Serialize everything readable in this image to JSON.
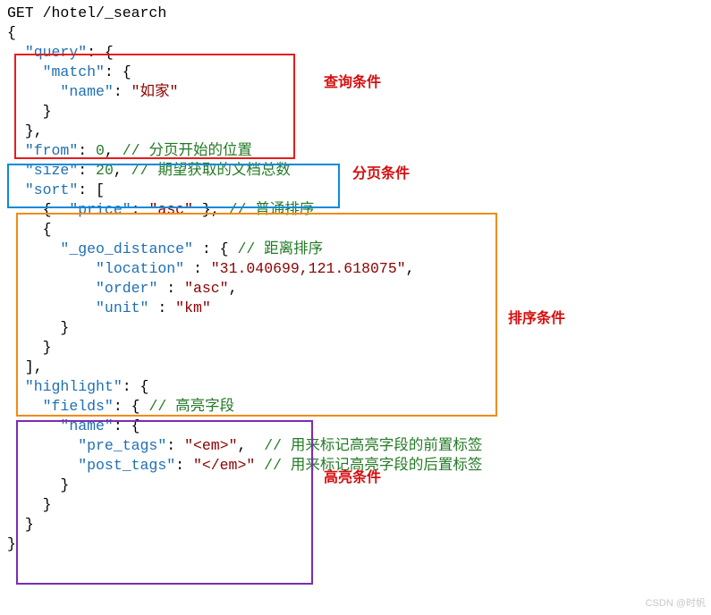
{
  "request_line": "GET /hotel/_search",
  "labels": {
    "query": "查询条件",
    "page": "分页条件",
    "sort": "排序条件",
    "highlight": "高亮条件"
  },
  "keys": {
    "query": "\"query\"",
    "match": "\"match\"",
    "name": "\"name\"",
    "from": "\"from\"",
    "size": "\"size\"",
    "sort": "\"sort\"",
    "price": "\"price\"",
    "geo": "\"_geo_distance\"",
    "location": "\"location\"",
    "order": "\"order\"",
    "unit": "\"unit\"",
    "highlight": "\"highlight\"",
    "fields": "\"fields\"",
    "pre_tags": "\"pre_tags\"",
    "post_tags": "\"post_tags\""
  },
  "vals": {
    "name": "\"如家\"",
    "from": "0",
    "size": "20",
    "asc": "\"asc\"",
    "loc": "\"31.040699,121.618075\"",
    "km": "\"km\"",
    "pre": "\"<em>\"",
    "post": "\"</em>\""
  },
  "comments": {
    "from": "// 分页开始的位置",
    "size": "// 期望获取的文档总数",
    "sort_plain": "// 普通排序",
    "sort_geo": "// 距离排序",
    "fields": "// 高亮字段",
    "pre": "// 用来标记高亮字段的前置标签",
    "post": "// 用来标记高亮字段的后置标签"
  },
  "watermark": "CSDN @时帆"
}
